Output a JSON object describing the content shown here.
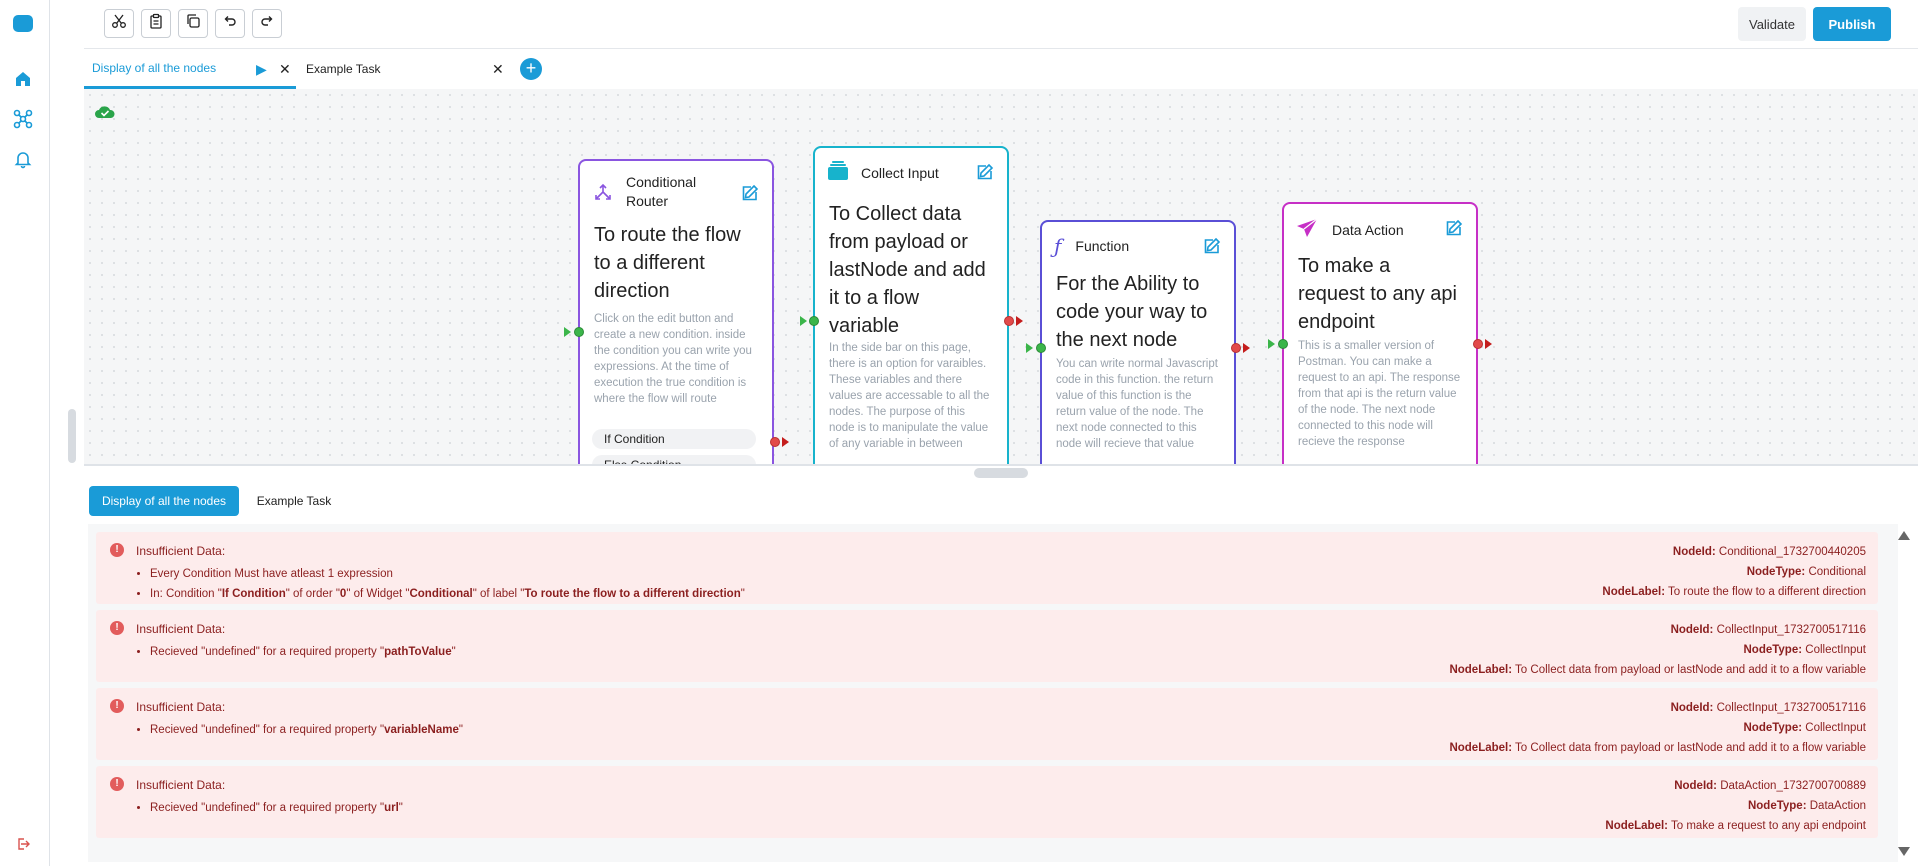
{
  "toolbar": {
    "validate_label": "Validate",
    "publish_label": "Publish"
  },
  "tabs": [
    {
      "label": "Display of all the nodes"
    },
    {
      "label": "Example Task"
    }
  ],
  "nodes": {
    "conditional": {
      "title": "Conditional Router",
      "description": "To route the flow to a different direction",
      "text": "Click on the edit button and create a new condition. inside the condition you can write you expressions. At the time of execution the true condition is where the flow will route",
      "conditions": [
        "If Condition",
        "Else Condition"
      ],
      "color": "#8a55e0"
    },
    "collect": {
      "title": "Collect Input",
      "description": "To Collect data from payload or lastNode and add it to a flow variable",
      "text": "In the side bar on this page, there is an option for varaibles. These variables and there values are accessable to all the nodes. The purpose of this node is to manipulate the value of any variable in between",
      "color": "#17b3cc"
    },
    "function": {
      "title": "Function",
      "description": "For the Ability to code your way to the next node",
      "text": "You can write normal Javascript code in this function. the return value of this function is the return value of the node. The next node connected to this node will recieve that value",
      "color": "#5a4fd6"
    },
    "data_action": {
      "title": "Data Action",
      "description": "To make a request to any api endpoint",
      "text": "This is a smaller version of Postman. You can make a request to an api. The response from that api is the return value of the node. The next node connected to this node will recieve the response",
      "color": "#c62fc6"
    }
  },
  "bottom_tabs": [
    {
      "label": "Display of all the nodes"
    },
    {
      "label": "Example Task"
    }
  ],
  "errors": [
    {
      "title": "Insufficient Data:",
      "items": [
        [
          {
            "t": "Every Condition Must have atleast 1 expression",
            "b": false
          }
        ],
        [
          {
            "t": "In: Condition \"",
            "b": false
          },
          {
            "t": "If Condition",
            "b": true
          },
          {
            "t": "\" of order \"",
            "b": false
          },
          {
            "t": "0",
            "b": true
          },
          {
            "t": "\" of Widget \"",
            "b": false
          },
          {
            "t": "Conditional",
            "b": true
          },
          {
            "t": "\" of label \"",
            "b": false
          },
          {
            "t": "To route the flow to a different direction",
            "b": true
          },
          {
            "t": "\"",
            "b": false
          }
        ]
      ],
      "node_id_label": "NodeId:",
      "node_id": "Conditional_1732700440205",
      "node_type_label": "NodeType:",
      "node_type": "Conditional",
      "node_label_label": "NodeLabel:",
      "node_label": "To route the flow to a different direction"
    },
    {
      "title": "Insufficient Data:",
      "items": [
        [
          {
            "t": "Recieved \"undefined\" for a required property \"",
            "b": false
          },
          {
            "t": "pathToValue",
            "b": true
          },
          {
            "t": "\"",
            "b": false
          }
        ]
      ],
      "node_id_label": "NodeId:",
      "node_id": "CollectInput_1732700517116",
      "node_type_label": "NodeType:",
      "node_type": "CollectInput",
      "node_label_label": "NodeLabel:",
      "node_label": "To Collect data from payload or lastNode and add it to a flow variable"
    },
    {
      "title": "Insufficient Data:",
      "items": [
        [
          {
            "t": "Recieved \"undefined\" for a required property \"",
            "b": false
          },
          {
            "t": "variableName",
            "b": true
          },
          {
            "t": "\"",
            "b": false
          }
        ]
      ],
      "node_id_label": "NodeId:",
      "node_id": "CollectInput_1732700517116",
      "node_type_label": "NodeType:",
      "node_type": "CollectInput",
      "node_label_label": "NodeLabel:",
      "node_label": "To Collect data from payload or lastNode and add it to a flow variable"
    },
    {
      "title": "Insufficient Data:",
      "items": [
        [
          {
            "t": "Recieved \"undefined\" for a required property \"",
            "b": false
          },
          {
            "t": "url",
            "b": true
          },
          {
            "t": "\"",
            "b": false
          }
        ]
      ],
      "node_id_label": "NodeId:",
      "node_id": "DataAction_1732700700889",
      "node_type_label": "NodeType:",
      "node_type": "DataAction",
      "node_label_label": "NodeLabel:",
      "node_label": "To make a request to any api endpoint"
    }
  ],
  "colors": {
    "accent": "#1a9bd7",
    "error_bg": "#fdecec",
    "error_text": "#8b1f1f",
    "port_in": "#3bb54a",
    "port_out": "#e24a4a"
  },
  "icons": {
    "sidebar": [
      "app-logo-icon",
      "home-icon",
      "flow-graph-icon",
      "bell-icon",
      "logout-icon"
    ],
    "toolbar": [
      "scissors-icon",
      "clipboard-icon",
      "copy-icon",
      "undo-icon",
      "redo-icon"
    ]
  }
}
